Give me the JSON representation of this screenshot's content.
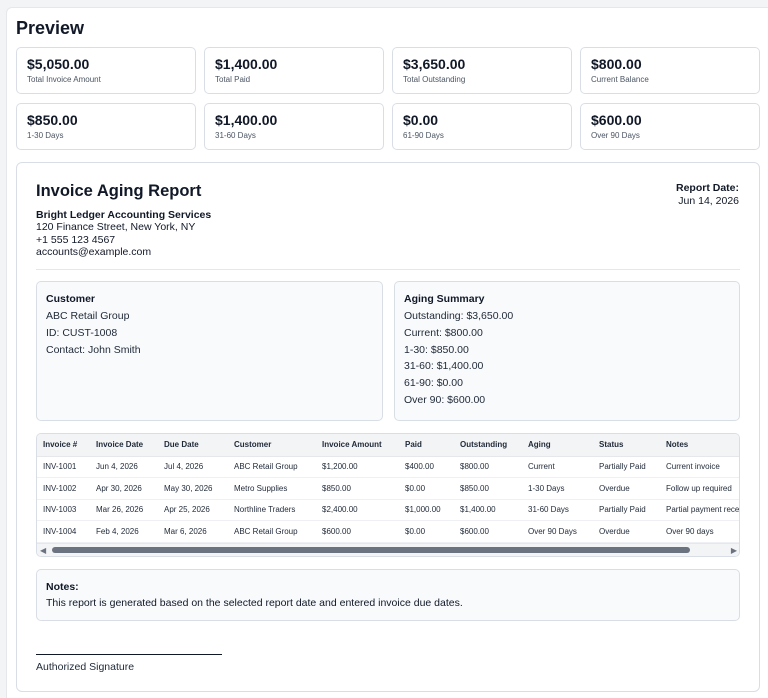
{
  "preview": {
    "title": "Preview"
  },
  "cards": [
    {
      "amount": "$5,050.00",
      "label": "Total Invoice Amount"
    },
    {
      "amount": "$1,400.00",
      "label": "Total Paid"
    },
    {
      "amount": "$3,650.00",
      "label": "Total Outstanding"
    },
    {
      "amount": "$800.00",
      "label": "Current Balance"
    },
    {
      "amount": "$850.00",
      "label": "1-30 Days"
    },
    {
      "amount": "$1,400.00",
      "label": "31-60 Days"
    },
    {
      "amount": "$0.00",
      "label": "61-90 Days"
    },
    {
      "amount": "$600.00",
      "label": "Over 90 Days"
    }
  ],
  "report": {
    "title": "Invoice Aging Report",
    "date_label": "Report Date:",
    "date_value": "Jun 14, 2026",
    "company": {
      "name": "Bright Ledger Accounting Services",
      "address": "120 Finance Street, New York, NY",
      "phone": "+1 555 123 4567",
      "email": "accounts@example.com"
    },
    "customer": {
      "heading": "Customer",
      "name": "ABC Retail Group",
      "id": "ID: CUST-1008",
      "contact": "Contact: John Smith"
    },
    "aging": {
      "heading": "Aging Summary",
      "lines": [
        "Outstanding: $3,650.00",
        "Current: $800.00",
        "1-30: $850.00",
        "31-60: $1,400.00",
        "61-90: $0.00",
        "Over 90: $600.00"
      ]
    },
    "table": {
      "headers": [
        "Invoice #",
        "Invoice Date",
        "Due Date",
        "Customer",
        "Invoice Amount",
        "Paid",
        "Outstanding",
        "Aging",
        "Status",
        "Notes"
      ],
      "rows": [
        [
          "INV-1001",
          "Jun 4, 2026",
          "Jul 4, 2026",
          "ABC Retail Group",
          "$1,200.00",
          "$400.00",
          "$800.00",
          "Current",
          "Partially Paid",
          "Current invoice"
        ],
        [
          "INV-1002",
          "Apr 30, 2026",
          "May 30, 2026",
          "Metro Supplies",
          "$850.00",
          "$0.00",
          "$850.00",
          "1-30 Days",
          "Overdue",
          "Follow up required"
        ],
        [
          "INV-1003",
          "Mar 26, 2026",
          "Apr 25, 2026",
          "Northline Traders",
          "$2,400.00",
          "$1,000.00",
          "$1,400.00",
          "31-60 Days",
          "Partially Paid",
          "Partial payment received"
        ],
        [
          "INV-1004",
          "Feb 4, 2026",
          "Mar 6, 2026",
          "ABC Retail Group",
          "$600.00",
          "$0.00",
          "$600.00",
          "Over 90 Days",
          "Overdue",
          "Over 90 days"
        ]
      ]
    },
    "notes": {
      "heading": "Notes:",
      "text": "This report is generated based on the selected report date and entered invoice due dates."
    },
    "signature_label": "Authorized Signature"
  },
  "icons": {
    "scroll_left": "caret-left-icon",
    "scroll_right": "caret-right-icon"
  }
}
